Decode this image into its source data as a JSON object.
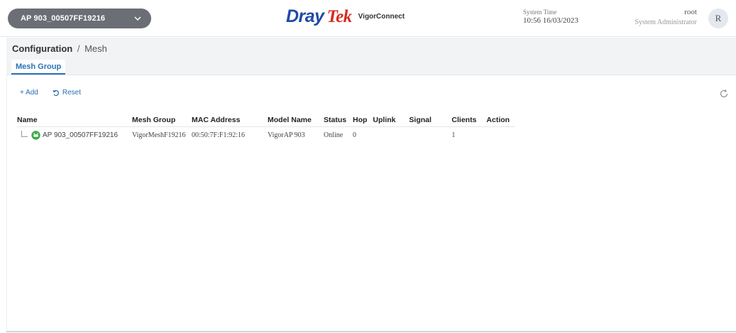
{
  "header": {
    "device_selector": "AP 903_00507FF19216",
    "brand_dray": "Dray",
    "brand_tek": "Tek",
    "product": "VigorConnect",
    "system_time_label": "System Time",
    "system_time_value": "10:56 16/03/2023",
    "user_name": "root",
    "user_role": "System Administrator",
    "avatar_letter": "R",
    "brand_colors": {
      "dray": "#1f4aa8",
      "tek": "#d62b20"
    }
  },
  "breadcrumb": {
    "current": "Configuration",
    "separator": "/",
    "sub": "Mesh"
  },
  "tabs": [
    {
      "label": "Mesh Group",
      "active": true
    }
  ],
  "toolbar": {
    "add_label": "+ Add",
    "reset_label": "Reset"
  },
  "table": {
    "columns": [
      "Name",
      "Mesh Group",
      "MAC Address",
      "Model Name",
      "Status",
      "Hop",
      "Uplink",
      "Signal",
      "Clients",
      "Action"
    ],
    "rows": [
      {
        "name": "AP 903_00507FF19216",
        "mesh_group": "VigorMeshF19216",
        "mac": "00:50:7F:F1:92:16",
        "model": "VigorAP 903",
        "status": "Online",
        "hop": "0",
        "uplink": "",
        "signal": "",
        "clients": "1",
        "action": "",
        "status_icon": "ap-online-icon",
        "status_color": "#3bab4a"
      }
    ]
  }
}
